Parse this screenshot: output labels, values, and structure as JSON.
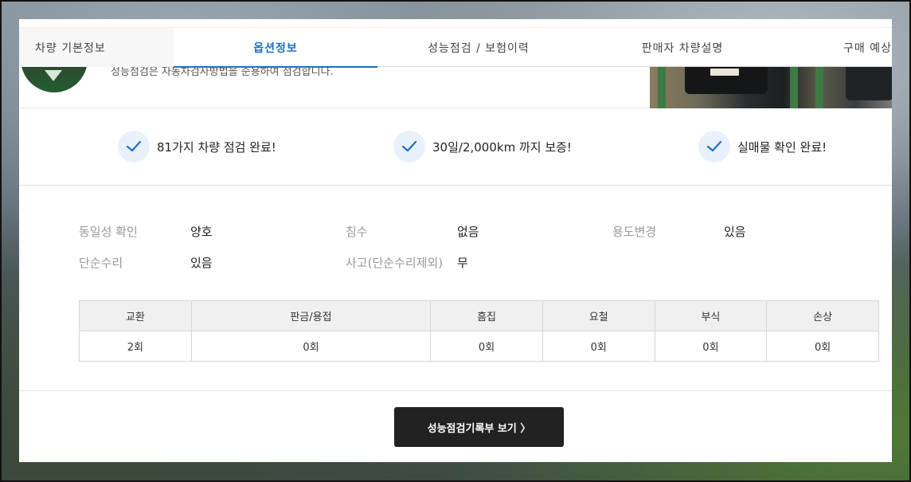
{
  "tabs": [
    {
      "label": "차량 기본정보"
    },
    {
      "label": "옵션정보"
    },
    {
      "label": "성능점검 / 보험이력"
    },
    {
      "label": "판매자 차량설명"
    },
    {
      "label": "구매 예상"
    }
  ],
  "hero": {
    "description": "성능점검은 자동차검사방법을 준용하여 점검합니다."
  },
  "checks": [
    {
      "text": "81가지 차량 점검 완료!"
    },
    {
      "text": "30일/2,000km 까지 보증!"
    },
    {
      "text": "실매물 확인 완료!"
    }
  ],
  "info": {
    "identity_label": "동일성 확인",
    "identity_value": "양호",
    "flood_label": "침수",
    "flood_value": "없음",
    "usage_label": "용도변경",
    "usage_value": "있음",
    "repair_label": "단순수리",
    "repair_value": "있음",
    "accident_label": "사고(단순수리제외)",
    "accident_value": "무"
  },
  "history_table": {
    "headers": [
      "교환",
      "판금/용접",
      "흠집",
      "요철",
      "부식",
      "손상"
    ],
    "values": [
      "2회",
      "0회",
      "0회",
      "0회",
      "0회",
      "0회"
    ]
  },
  "cta": {
    "label": "성능점검기록부 보기 〉"
  },
  "colors": {
    "accent": "#1f6fc0",
    "check_bg": "#e8f1fb",
    "button_bg": "#222222"
  }
}
